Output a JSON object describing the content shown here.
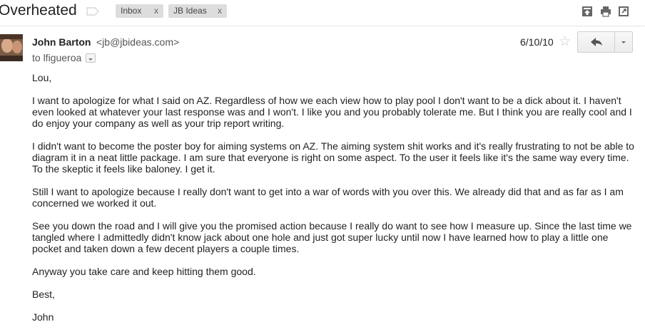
{
  "subject": "Overheated",
  "labels": [
    {
      "name": "Inbox",
      "remove": "x"
    },
    {
      "name": "JB Ideas",
      "remove": "x"
    }
  ],
  "header_icons": [
    "archive-icon",
    "print-icon",
    "new-window-icon"
  ],
  "message": {
    "sender_name": "John Barton",
    "sender_email": "<jb@jbideas.com>",
    "to": "to lfigueroa",
    "date": "6/10/10",
    "star": "☆",
    "greeting": "Lou,",
    "paragraphs": [
      "I want to apologize for what I said on AZ.  Regardless of how we each view how to play pool I don't want to be a dick about it.  I haven't even looked at whatever your last response was and I won't.  I like you and you probably tolerate me.  But I think you are really cool and I do enjoy your company as well as your trip report writing.",
      "I didn't want to become the poster boy for aiming systems on AZ.  The aiming system shit works and it's really frustrating to not be able to diagram it in a neat little package.  I am sure that everyone is right on some aspect.  To the user it feels like it's the same way every time.  To the skeptic it feels like baloney.  I get it.",
      "Still I want to apologize because I really don't want to get into a war of words with you over this.  We already did that and as far as I am concerned we worked it out.",
      "See you down the road and I will give you the promised action because I really do want to see how I measure up.  Since the last time we tangled where I admittedly didn't know jack about one hole and just got super lucky until now I have learned how to play a little one pocket and taken down a few decent players a couple times.",
      "Anyway you take care and keep hitting them good."
    ],
    "closing": "Best,",
    "signature": "John"
  },
  "colors": {
    "label_bg": "#dddddd",
    "star": "#c8c8c8",
    "text": "#222222"
  }
}
